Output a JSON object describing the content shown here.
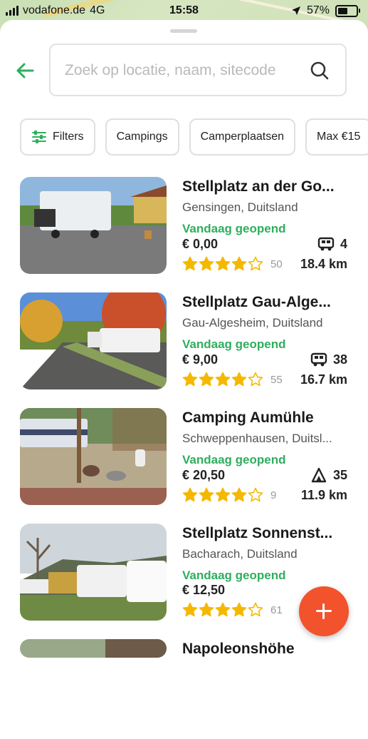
{
  "status_bar": {
    "carrier": "vodafone.de",
    "network": "4G",
    "time": "15:58",
    "battery": "57%",
    "battery_level": 0.57
  },
  "search": {
    "placeholder": "Zoek op locatie, naam, sitecode"
  },
  "filters": [
    {
      "label": "Filters",
      "icon": "sliders-icon"
    },
    {
      "label": "Campings"
    },
    {
      "label": "Camperplaatsen"
    },
    {
      "label": "Max €15"
    }
  ],
  "listings": [
    {
      "title": "Stellplatz an der Go...",
      "location": "Gensingen, Duitsland",
      "status": "Vandaag geopend",
      "price": "€ 0,00",
      "spot_icon": "camper-icon",
      "spots": "4",
      "rating": 4,
      "reviews": "50",
      "distance": "18.4 km"
    },
    {
      "title": "Stellplatz Gau-Alge...",
      "location": "Gau-Algesheim, Duitsland",
      "status": "Vandaag geopend",
      "price": "€ 9,00",
      "spot_icon": "camper-icon",
      "spots": "38",
      "rating": 4,
      "reviews": "55",
      "distance": "16.7 km"
    },
    {
      "title": "Camping Aumühle",
      "location": "Schweppenhausen, Duitsl...",
      "status": "Vandaag geopend",
      "price": "€ 20,50",
      "spot_icon": "tent-icon",
      "spots": "35",
      "rating": 4,
      "reviews": "9",
      "distance": "11.9 km"
    },
    {
      "title": "Stellplatz Sonnenst...",
      "location": "Bacharach, Duitsland",
      "status": "Vandaag geopend",
      "price": "€ 12,50",
      "spot_icon": "",
      "spots": "",
      "rating": 4,
      "reviews": "61",
      "distance": ""
    },
    {
      "title": "Napoleonshöhe",
      "location": "",
      "status": "",
      "price": "",
      "spot_icon": "",
      "spots": "",
      "rating": 0,
      "reviews": "",
      "distance": ""
    }
  ],
  "colors": {
    "accent": "#2fae5e",
    "star": "#f5b800",
    "fab": "#f2532d"
  }
}
